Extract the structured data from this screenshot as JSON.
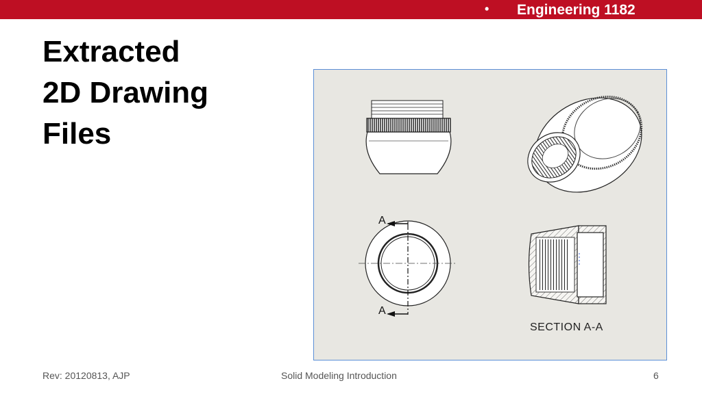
{
  "header": {
    "bullet": "•",
    "course": "Engineering 1182",
    "bar_color": "#be0f23"
  },
  "title": {
    "lines": [
      "Extracted",
      "2D Drawing",
      "Files"
    ]
  },
  "drawing": {
    "section_marker_top": "A",
    "section_marker_bottom": "A",
    "section_caption": "SECTION A-A"
  },
  "footer": {
    "left": "Rev: 20120813, AJP",
    "center": "Solid Modeling Introduction",
    "page": "6"
  }
}
